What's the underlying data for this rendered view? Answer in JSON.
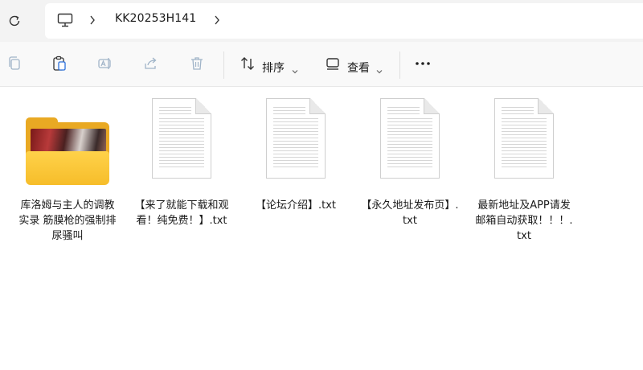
{
  "address_bar": {
    "breadcrumbs": [
      "KK20253H141"
    ]
  },
  "toolbar": {
    "sort_label": "排序",
    "view_label": "查看"
  },
  "files": [
    {
      "name": "库洛姆与主人的调教实录 筋膜枪的强制排尿骚叫",
      "type": "folder",
      "icon": "folder-icon"
    },
    {
      "name": "【来了就能下载和观看！纯免费！】.txt",
      "type": "txt",
      "icon": "text-file-icon"
    },
    {
      "name": "【论坛介绍】.txt",
      "type": "txt",
      "icon": "text-file-icon"
    },
    {
      "name": "【永久地址发布页】.txt",
      "type": "txt",
      "icon": "text-file-icon"
    },
    {
      "name": "最新地址及APP请发邮箱自动获取！！！.txt",
      "type": "txt",
      "icon": "text-file-icon"
    }
  ],
  "colors": {
    "folder_yellow": "#f6bd2a",
    "address_bg": "#f3f3f3",
    "toolbar_bg": "#f9f9f9"
  }
}
